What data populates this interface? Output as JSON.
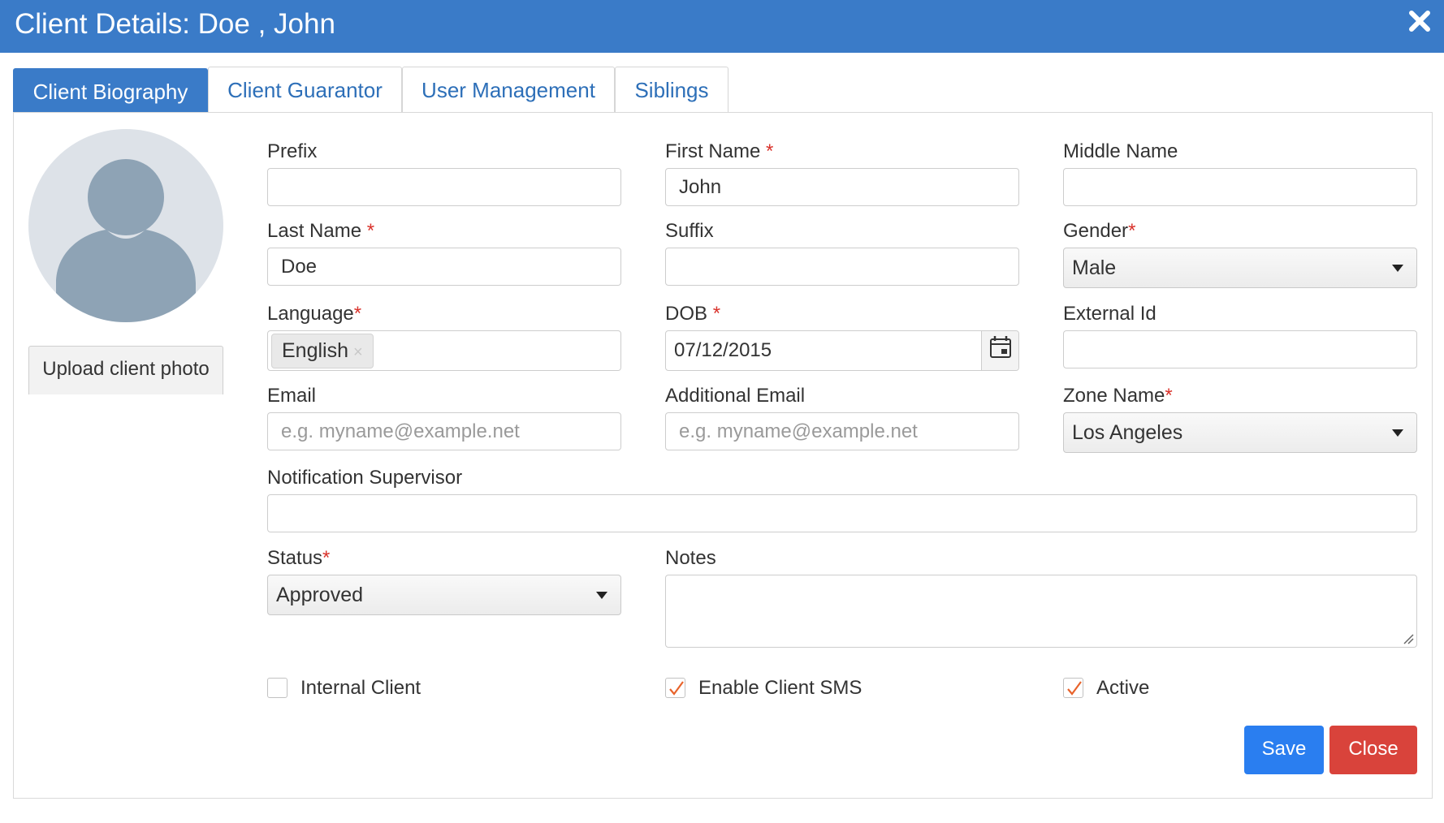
{
  "window": {
    "title": "Client Details: Doe , John",
    "close_icon": "close-icon"
  },
  "tabs": [
    {
      "label": "Client Biography",
      "active": true
    },
    {
      "label": "Client Guarantor",
      "active": false
    },
    {
      "label": "User Management",
      "active": false
    },
    {
      "label": "Siblings",
      "active": false
    }
  ],
  "avatar": {
    "icon": "user-avatar-icon",
    "upload_label": "Upload client photo"
  },
  "form": {
    "prefix": {
      "label": "Prefix",
      "value": ""
    },
    "first_name": {
      "label": "First Name",
      "required": "*",
      "value": "John"
    },
    "middle_name": {
      "label": "Middle Name",
      "value": ""
    },
    "last_name": {
      "label": "Last Name",
      "required": "*",
      "value": "Doe"
    },
    "suffix": {
      "label": "Suffix",
      "value": ""
    },
    "gender": {
      "label": "Gender",
      "required": "*",
      "value": "Male"
    },
    "language": {
      "label": "Language",
      "required": "*",
      "value": "English",
      "remove_glyph": "×"
    },
    "dob": {
      "label": "DOB",
      "required": "*",
      "value": "07/12/2015",
      "icon": "calendar-icon"
    },
    "external_id": {
      "label": "External Id",
      "value": ""
    },
    "email": {
      "label": "Email",
      "placeholder": "e.g. myname@example.net"
    },
    "additional_email": {
      "label": "Additional Email",
      "placeholder": "e.g. myname@example.net"
    },
    "zone_name": {
      "label": "Zone Name",
      "required": "*",
      "value": "Los Angeles"
    },
    "notification_supervisor": {
      "label": "Notification Supervisor",
      "value": ""
    },
    "status": {
      "label": "Status",
      "required": "*",
      "value": "Approved"
    },
    "notes": {
      "label": "Notes",
      "value": ""
    },
    "internal_client": {
      "label": "Internal Client",
      "checked": false
    },
    "enable_sms": {
      "label": "Enable Client SMS",
      "checked": true
    },
    "active": {
      "label": "Active",
      "checked": true
    }
  },
  "actions": {
    "save_label": "Save",
    "close_label": "Close"
  },
  "colors": {
    "header": "#3a7bc8",
    "tab_text": "#2d6fb8",
    "required": "#d9322b",
    "checkmark": "#e8632b",
    "save": "#2a7ef0",
    "close": "#d9433b"
  }
}
